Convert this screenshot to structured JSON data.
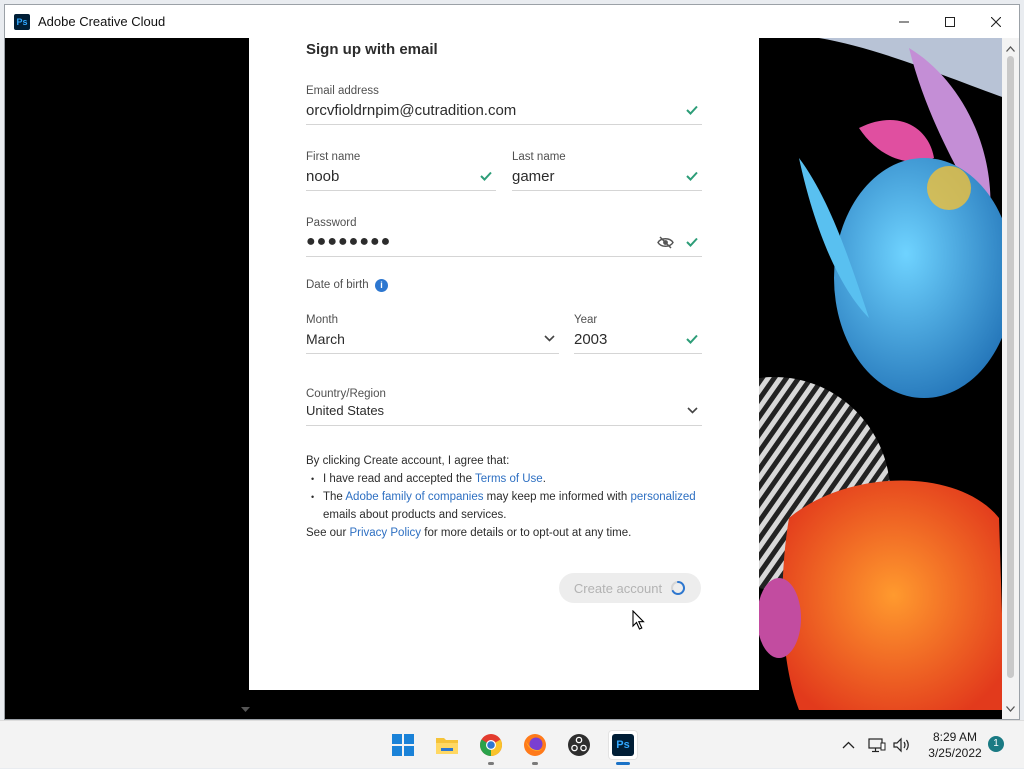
{
  "window": {
    "title": "Adobe Creative Cloud",
    "app_icon_text": "Ps"
  },
  "form": {
    "title": "Sign up with email",
    "email": {
      "label": "Email address",
      "value": "orcvfioldrnpim@cutradition.com"
    },
    "first_name": {
      "label": "First name",
      "value": "noob"
    },
    "last_name": {
      "label": "Last name",
      "value": "gamer"
    },
    "password": {
      "label": "Password",
      "value": "●●●●●●●●"
    },
    "dob": {
      "label": "Date of birth"
    },
    "month": {
      "label": "Month",
      "value": "March"
    },
    "year": {
      "label": "Year",
      "value": "2003"
    },
    "country": {
      "label": "Country/Region",
      "value": "United States"
    },
    "legal": {
      "intro": "By clicking Create account, I agree that:",
      "bullet1_pre": "I have read and accepted the ",
      "bullet1_link": "Terms of Use",
      "bullet1_post": ".",
      "bullet2_pre": "The ",
      "bullet2_link1": "Adobe family of companies",
      "bullet2_mid": " may keep me informed with ",
      "bullet2_link2": "personalized",
      "bullet2_post": " emails about products and services.",
      "privacy_pre": "See our ",
      "privacy_link": "Privacy Policy",
      "privacy_post": " for more details or to opt-out at any time."
    },
    "create_button": "Create account"
  },
  "taskbar": {
    "apps": [
      "windows-start",
      "file-explorer",
      "chrome",
      "firefox",
      "obs",
      "photoshop"
    ],
    "ps_label": "Ps",
    "time": "8:29 AM",
    "date": "3/25/2022",
    "notification_count": "1"
  },
  "colors": {
    "accent": "#2d6fc2",
    "check": "#2d9d78",
    "taskbar_active": "#1a72c7"
  }
}
